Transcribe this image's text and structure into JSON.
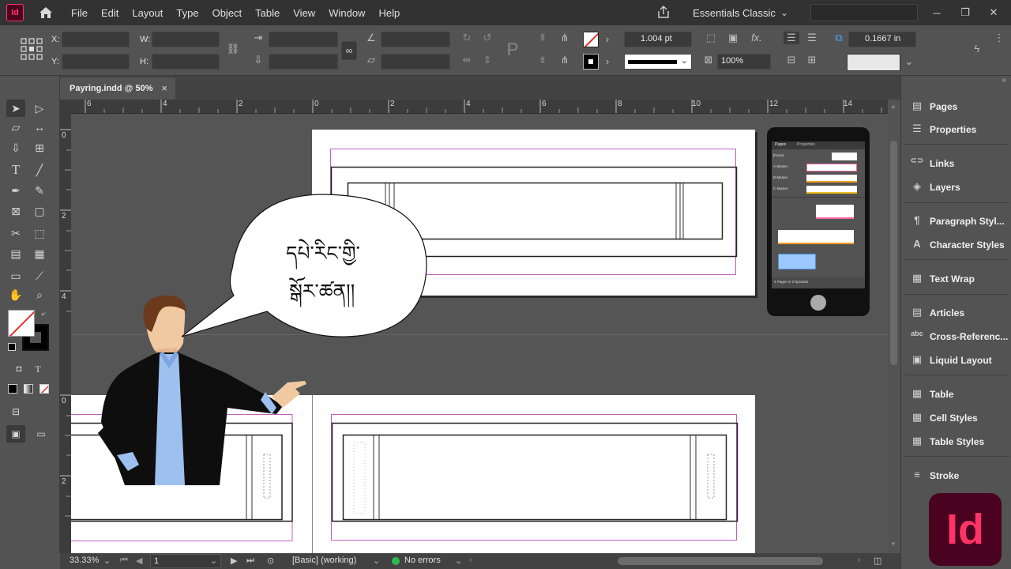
{
  "app": {
    "icon_label": "Id",
    "logo_text": "Id"
  },
  "menu": [
    "File",
    "Edit",
    "Layout",
    "Type",
    "Object",
    "Table",
    "View",
    "Window",
    "Help"
  ],
  "workspace": "Essentials Classic",
  "window_controls": [
    "─",
    "❐",
    "✕"
  ],
  "control": {
    "x_label": "X:",
    "y_label": "Y:",
    "w_label": "W:",
    "h_label": "H:",
    "stroke_weight": "1.004 pt",
    "scale": "100%",
    "gutter": "0.1667 in"
  },
  "document_tab": {
    "title": "Payring.indd @ 50%",
    "close": "×"
  },
  "rulers": {
    "horizontal": [
      "6",
      "4",
      "2",
      "0",
      "2",
      "4",
      "6",
      "8",
      "10",
      "12",
      "14"
    ],
    "vertical": [
      "0",
      "2",
      "4",
      "0",
      "2"
    ]
  },
  "speech_bubble_text": [
    "དཔེ་རིང་གྱི་",
    "སྒོར་ཚན།།"
  ],
  "phone_panel": {
    "tabs": [
      "Pages",
      "Properties"
    ],
    "masters": [
      "[None]",
      "A-Master",
      "B-Master",
      "C-Master"
    ],
    "footer": "4 Pages in 3 Spreads"
  },
  "panels": [
    {
      "label": "Pages",
      "icon": "pages-icon",
      "glyph": "▤"
    },
    {
      "label": "Properties",
      "icon": "properties-icon",
      "glyph": "☰"
    },
    {
      "label": "Links",
      "icon": "links-icon",
      "glyph": "⊂⊃"
    },
    {
      "label": "Layers",
      "icon": "layers-icon",
      "glyph": "◈"
    },
    {
      "label": "Paragraph Styl...",
      "icon": "paragraph-styles-icon",
      "glyph": "¶"
    },
    {
      "label": "Character Styles",
      "icon": "character-styles-icon",
      "glyph": "A"
    },
    {
      "label": "Text Wrap",
      "icon": "text-wrap-icon",
      "glyph": "▦"
    },
    {
      "label": "Articles",
      "icon": "articles-icon",
      "glyph": "▤"
    },
    {
      "label": "Cross-Referenc...",
      "icon": "cross-references-icon",
      "glyph": "abc"
    },
    {
      "label": "Liquid Layout",
      "icon": "liquid-layout-icon",
      "glyph": "▣"
    },
    {
      "label": "Table",
      "icon": "table-icon",
      "glyph": "▦"
    },
    {
      "label": "Cell Styles",
      "icon": "cell-styles-icon",
      "glyph": "▦"
    },
    {
      "label": "Table Styles",
      "icon": "table-styles-icon",
      "glyph": "▦"
    },
    {
      "label": "Stroke",
      "icon": "stroke-icon",
      "glyph": "≡"
    }
  ],
  "status": {
    "zoom": "33.33%",
    "page": "1",
    "profile": "[Basic] (working)",
    "errors": "No errors"
  },
  "colors": {
    "accent": "#ff3366",
    "logo_bg": "#49021f",
    "no_error": "#2db84a"
  }
}
